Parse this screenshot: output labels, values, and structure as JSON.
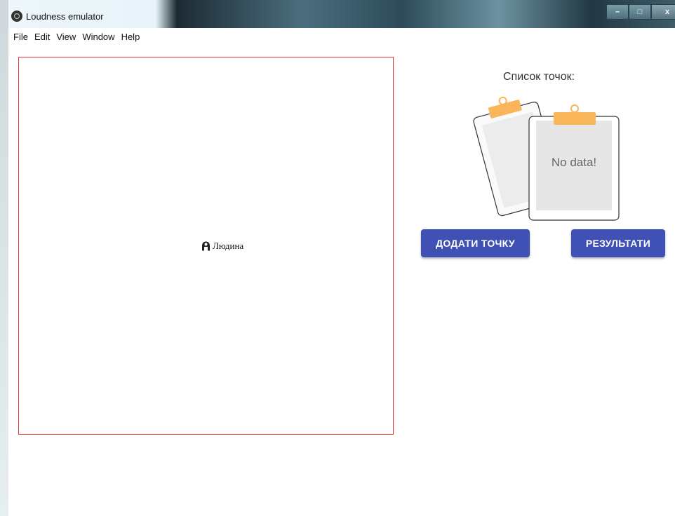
{
  "window": {
    "title": "Loudness emulator",
    "controls": {
      "minimize": "–",
      "maximize": "□",
      "close": "x"
    }
  },
  "menu": {
    "items": [
      "File",
      "Edit",
      "View",
      "Window",
      "Help"
    ]
  },
  "canvas": {
    "person_label": "Людина",
    "person_icon": "person-icon",
    "border_color": "#e53935"
  },
  "points": {
    "title": "Список точок:",
    "empty_text": "No data!"
  },
  "actions": {
    "add_point": "ДОДАТИ ТОЧКУ",
    "results": "РЕЗУЛЬТАТИ"
  },
  "colors": {
    "primary": "#3f51b5",
    "clip": "#f9b55a"
  }
}
